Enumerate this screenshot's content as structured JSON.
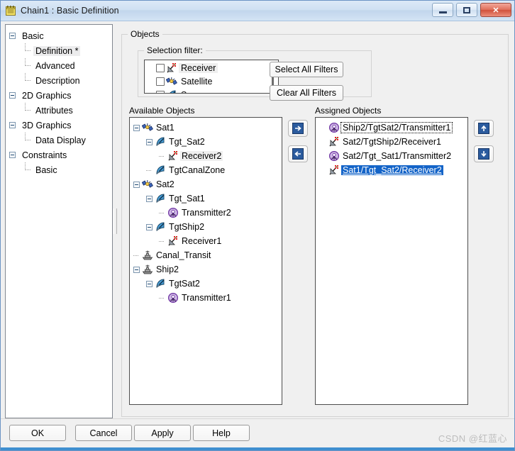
{
  "window": {
    "title": "Chain1 : Basic Definition",
    "icon": "notepad-icon",
    "minimize_label": "",
    "maximize_label": "",
    "close_label": "✕"
  },
  "nav_tree": [
    {
      "label": "Basic",
      "level": 0,
      "expander": true,
      "selected": false
    },
    {
      "label": "Definition *",
      "level": 1,
      "expander": false,
      "selected": true
    },
    {
      "label": "Advanced",
      "level": 1,
      "expander": false,
      "selected": false
    },
    {
      "label": "Description",
      "level": 1,
      "expander": false,
      "selected": false,
      "last": true
    },
    {
      "label": "2D Graphics",
      "level": 0,
      "expander": true,
      "selected": false
    },
    {
      "label": "Attributes",
      "level": 1,
      "expander": false,
      "selected": false,
      "last": true
    },
    {
      "label": "3D Graphics",
      "level": 0,
      "expander": true,
      "selected": false
    },
    {
      "label": "Data Display",
      "level": 1,
      "expander": false,
      "selected": false,
      "last": true
    },
    {
      "label": "Constraints",
      "level": 0,
      "expander": true,
      "selected": false
    },
    {
      "label": "Basic",
      "level": 1,
      "expander": false,
      "selected": false,
      "last": true
    }
  ],
  "objects_group": {
    "title": "Objects"
  },
  "selection_filter": {
    "title": "Selection filter:",
    "items": [
      {
        "label": "Receiver",
        "icon": "receiver-icon",
        "checked": false,
        "highlighted": true
      },
      {
        "label": "Satellite",
        "icon": "satellite-icon",
        "checked": false,
        "highlighted": false
      },
      {
        "label": "Sensor",
        "icon": "sensor-icon",
        "checked": false,
        "highlighted": false
      }
    ],
    "select_all_label": "Select All Filters",
    "clear_all_label": "Clear All Filters"
  },
  "available_objects": {
    "caption": "Available Objects",
    "items": [
      {
        "label": "Sat1",
        "indent": 0,
        "icon": "satellite-icon",
        "expander": true
      },
      {
        "label": "Tgt_Sat2",
        "indent": 1,
        "icon": "sensor-icon",
        "expander": true
      },
      {
        "label": "Receiver2",
        "indent": 2,
        "icon": "receiver-icon",
        "expander": false,
        "highlighted": true
      },
      {
        "label": "TgtCanalZone",
        "indent": 1,
        "icon": "sensor-icon",
        "expander": false
      },
      {
        "label": "Sat2",
        "indent": 0,
        "icon": "satellite-icon",
        "expander": true
      },
      {
        "label": "Tgt_Sat1",
        "indent": 1,
        "icon": "sensor-icon",
        "expander": true
      },
      {
        "label": "Transmitter2",
        "indent": 2,
        "icon": "transmitter-icon",
        "expander": false
      },
      {
        "label": "TgtShip2",
        "indent": 1,
        "icon": "sensor-icon",
        "expander": true
      },
      {
        "label": "Receiver1",
        "indent": 2,
        "icon": "receiver-icon",
        "expander": false
      },
      {
        "label": "Canal_Transit",
        "indent": 0,
        "icon": "ship-icon",
        "expander": false
      },
      {
        "label": "Ship2",
        "indent": 0,
        "icon": "ship-icon",
        "expander": true
      },
      {
        "label": "TgtSat2",
        "indent": 1,
        "icon": "sensor-icon",
        "expander": true
      },
      {
        "label": "Transmitter1",
        "indent": 2,
        "icon": "transmitter-icon",
        "expander": false
      }
    ]
  },
  "assigned_objects": {
    "caption": "Assigned Objects",
    "items": [
      {
        "label": "Ship2/TgtSat2/Transmitter1",
        "icon": "transmitter-icon",
        "selected": false,
        "focused": true
      },
      {
        "label": "Sat2/TgtShip2/Receiver1",
        "icon": "receiver-icon",
        "selected": false,
        "focused": false
      },
      {
        "label": "Sat2/Tgt_Sat1/Transmitter2",
        "icon": "transmitter-icon",
        "selected": false,
        "focused": false
      },
      {
        "label": "Sat1/Tgt_Sat2/Receiver2",
        "icon": "receiver-icon",
        "selected": true,
        "focused": false
      }
    ]
  },
  "transfer_buttons": {
    "add_label": "➜",
    "add_icon": "arrow-right-icon",
    "remove_label": "➜",
    "remove_icon": "arrow-left-icon"
  },
  "order_buttons": {
    "up_label": "➜",
    "up_icon": "arrow-up-icon",
    "down_label": "➜",
    "down_icon": "arrow-down-icon"
  },
  "footer": {
    "ok_label": "OK",
    "cancel_label": "Cancel",
    "apply_label": "Apply",
    "help_label": "Help",
    "watermark": "CSDN @红蓝心"
  },
  "colors": {
    "selection_blue": "#1464c8",
    "title_gradient_top": "#dce9f7",
    "accent_button_blue": "#2b5b9e",
    "close_red": "#d0513c"
  }
}
